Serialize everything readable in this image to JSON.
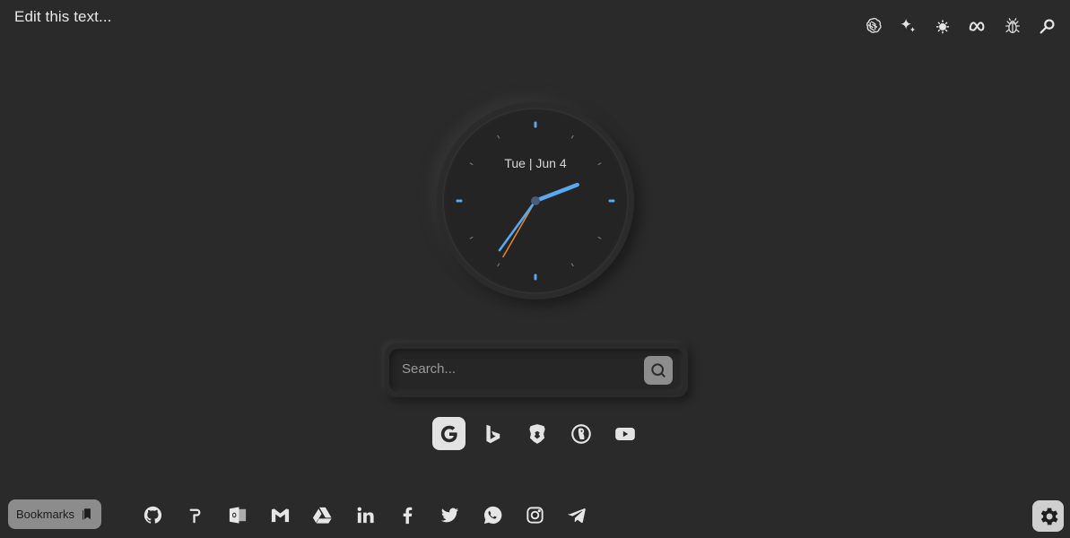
{
  "header": {
    "edit_text": "Edit this text..."
  },
  "top_icons": [
    {
      "name": "chatgpt-icon"
    },
    {
      "name": "gemini-sparkle-icon"
    },
    {
      "name": "brightness-icon"
    },
    {
      "name": "meta-icon"
    },
    {
      "name": "bug-icon"
    },
    {
      "name": "search-tool-icon"
    }
  ],
  "clock": {
    "date_text": "Tue | Jun 4",
    "hour_value": 2.3,
    "minute_value": 36,
    "second_value": 35,
    "colors": {
      "hour": "#5aa8f0",
      "minute": "#5aa8f0",
      "second": "#e0822e",
      "marker": "#5aa8f0",
      "tick": "#777777"
    }
  },
  "search": {
    "placeholder": "Search..."
  },
  "engines": [
    {
      "name": "google",
      "active": true
    },
    {
      "name": "bing",
      "active": false
    },
    {
      "name": "brave",
      "active": false
    },
    {
      "name": "duckduckgo",
      "active": false
    },
    {
      "name": "youtube",
      "active": false
    }
  ],
  "bookmarks": {
    "label": "Bookmarks"
  },
  "bottom_links": [
    {
      "name": "github-icon"
    },
    {
      "name": "perplexity-icon"
    },
    {
      "name": "outlook-icon"
    },
    {
      "name": "gmail-icon"
    },
    {
      "name": "google-drive-icon"
    },
    {
      "name": "linkedin-icon"
    },
    {
      "name": "facebook-icon"
    },
    {
      "name": "twitter-icon"
    },
    {
      "name": "whatsapp-icon"
    },
    {
      "name": "instagram-icon"
    },
    {
      "name": "telegram-icon"
    }
  ]
}
